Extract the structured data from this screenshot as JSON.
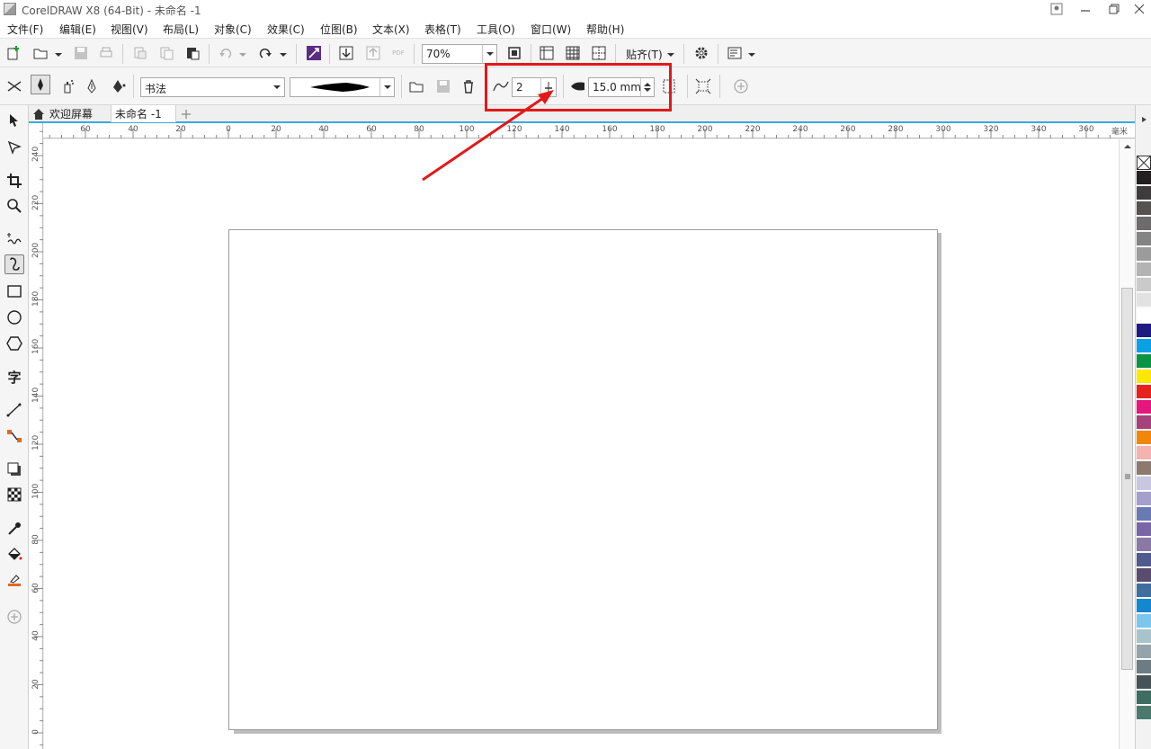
{
  "window": {
    "title": "CorelDRAW X8 (64-Bit) - 未命名 -1"
  },
  "menu": [
    "文件(F)",
    "编辑(E)",
    "视图(V)",
    "布局(L)",
    "对象(C)",
    "效果(C)",
    "位图(B)",
    "文本(X)",
    "表格(T)",
    "工具(O)",
    "窗口(W)",
    "帮助(H)"
  ],
  "std_toolbar": {
    "zoom": "70%",
    "snap_label": "贴齐(T)",
    "pdf_label": "PDF"
  },
  "prop_bar": {
    "preset_style": "书法",
    "smoothing_value": "2",
    "width_value": "15.0 mm"
  },
  "tabs": [
    {
      "label": "欢迎屏幕"
    },
    {
      "label": "未命名 -1"
    }
  ],
  "ruler_top": {
    "unit": "毫米",
    "labels": [
      "60",
      "40",
      "20",
      "0",
      "20",
      "40",
      "60",
      "80",
      "100",
      "120",
      "140",
      "160",
      "180",
      "200",
      "220",
      "240",
      "260",
      "280",
      "300",
      "320",
      "340",
      "360"
    ]
  },
  "ruler_left": {
    "labels": [
      "240",
      "220",
      "200",
      "180",
      "160",
      "140",
      "120",
      "100",
      "80",
      "60",
      "40",
      "20",
      "0"
    ]
  },
  "palette": {
    "colors": [
      "#231f20",
      "#3d3b3c",
      "#55524f",
      "#6d6b6b",
      "#858484",
      "#9c9b9b",
      "#b4b3b3",
      "#cbcaca",
      "#e2e2e2",
      "#ffffff",
      "#1f1a83",
      "#0aa0e6",
      "#0b9444",
      "#ffe800",
      "#e6211f",
      "#e6157f",
      "#a5427c",
      "#f0870a",
      "#f4b2b0",
      "#8c7a6e",
      "#c8c6e0",
      "#a49fcb",
      "#6b79b2",
      "#7a65a6",
      "#8b79a5",
      "#4f5b8c",
      "#5a4c6e",
      "#3f6e9f",
      "#1487cf",
      "#7cc5ed",
      "#a8c3cc",
      "#95a4ac",
      "#6b7c83",
      "#455258",
      "#3e6d62",
      "#4a7a6d"
    ]
  }
}
